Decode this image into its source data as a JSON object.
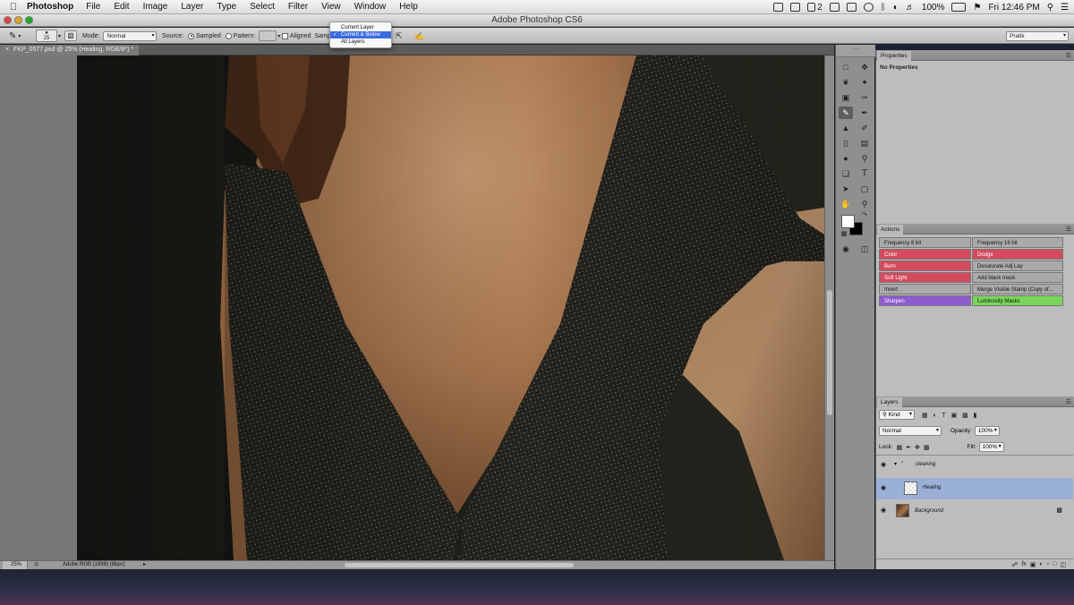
{
  "menubar": {
    "apple": "",
    "app_name": "Photoshop",
    "items": [
      "File",
      "Edit",
      "Image",
      "Layer",
      "Type",
      "Select",
      "Filter",
      "View",
      "Window",
      "Help"
    ],
    "status": {
      "adobe_count": "2",
      "battery": "100%",
      "clock": "Fri 12:46 PM"
    }
  },
  "window": {
    "title": "Adobe Photoshop CS6"
  },
  "options_bar": {
    "brush_size": "25",
    "mode_label": "Mode:",
    "mode_value": "Normal",
    "source_label": "Source:",
    "source_sampled": "Sampled",
    "source_pattern": "Pattern:",
    "aligned_label": "Aligned",
    "sample_label": "Sample:",
    "workspace": "Pratik"
  },
  "sample_menu": {
    "options": [
      "Current Layer",
      "Current & Below",
      "All Layers"
    ],
    "selected_index": 1,
    "check": "✓"
  },
  "document": {
    "tab_label": "FKP_0577.psd @ 25% (Healing, RGB/8*) *"
  },
  "status_bar": {
    "zoom": "25%",
    "profile": "Adobe RGB (1998) (8bpc)"
  },
  "colors": {
    "foreground": "#ffffff",
    "background": "#000000"
  },
  "properties_panel": {
    "tab": "Properties",
    "content": "No Properties"
  },
  "actions_panel": {
    "tab": "Actions",
    "buttons": [
      {
        "label": "Frequency 8 bit",
        "color": "none"
      },
      {
        "label": "Frequency 16 bit",
        "color": "none"
      },
      {
        "label": "Color",
        "color": "red"
      },
      {
        "label": "Dodge",
        "color": "red"
      },
      {
        "label": "Burn",
        "color": "red"
      },
      {
        "label": "Desaturate Adj Lay",
        "color": "none"
      },
      {
        "label": "Soft Light",
        "color": "red"
      },
      {
        "label": "Add black mask",
        "color": "none"
      },
      {
        "label": "Invert",
        "color": "none"
      },
      {
        "label": "Merge Visible Stamp (Copy of...",
        "color": "none"
      },
      {
        "label": "Sharpen",
        "color": "violet"
      },
      {
        "label": "Luminosity Masks",
        "color": "green"
      }
    ]
  },
  "layers_panel": {
    "tab": "Layers",
    "filter": "Kind",
    "blend_mode": "Normal",
    "opacity_label": "Opacity:",
    "opacity": "100%",
    "lock_label": "Lock:",
    "fill_label": "Fill:",
    "fill": "100%",
    "layers": [
      {
        "name": "cleaning",
        "type": "group"
      },
      {
        "name": "Healing",
        "type": "layer",
        "selected": true
      },
      {
        "name": "Background",
        "type": "background",
        "locked": true
      }
    ]
  }
}
